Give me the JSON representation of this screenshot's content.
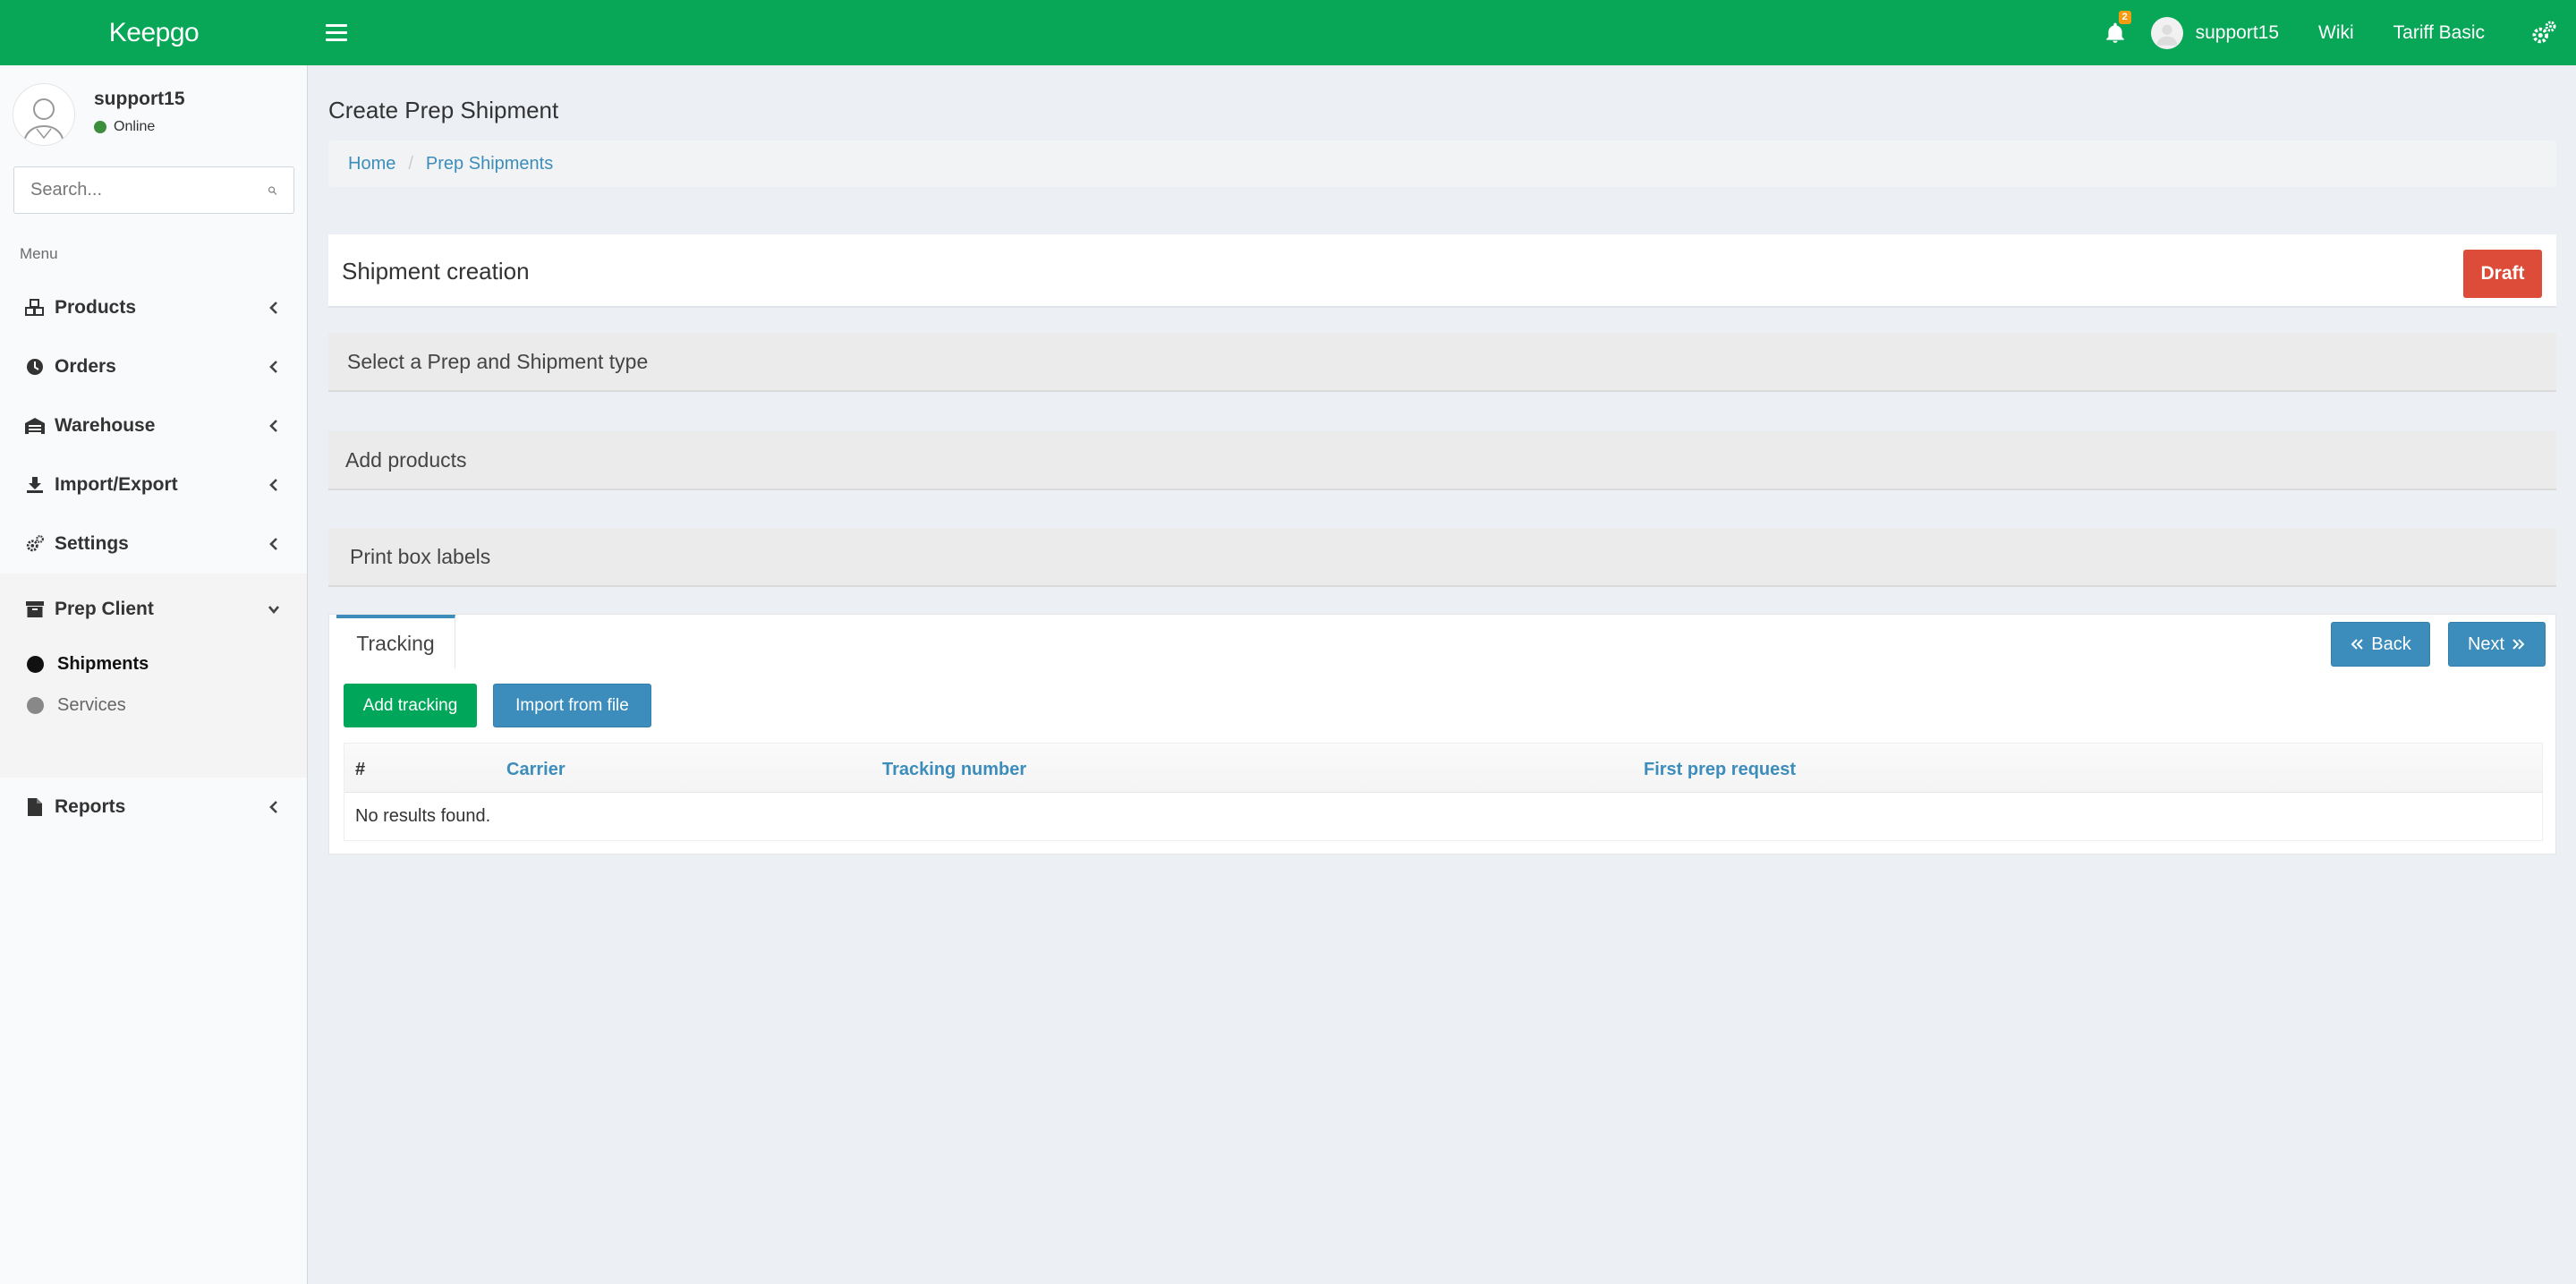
{
  "header": {
    "logo": "Keepgo",
    "notifications_count": "2",
    "username": "support15",
    "wiki": "Wiki",
    "tariff": "Tariff Basic"
  },
  "sidebar": {
    "user": {
      "name": "support15",
      "status": "Online"
    },
    "search": {
      "placeholder": "Search..."
    },
    "menu_header": "Menu",
    "items": [
      {
        "label": "Products",
        "icon": "cubes-icon"
      },
      {
        "label": "Orders",
        "icon": "clock-icon"
      },
      {
        "label": "Warehouse",
        "icon": "warehouse-icon"
      },
      {
        "label": "Import/Export",
        "icon": "download-icon"
      },
      {
        "label": "Settings",
        "icon": "gears-icon"
      },
      {
        "label": "Prep Client",
        "icon": "archive-icon"
      },
      {
        "label": "Reports",
        "icon": "file-icon"
      }
    ],
    "subitems": [
      {
        "label": "Shipments",
        "active": true
      },
      {
        "label": "Services",
        "active": false
      }
    ]
  },
  "content": {
    "page_title": "Create Prep Shipment",
    "breadcrumb": {
      "home": "Home",
      "current": "Prep Shipments"
    },
    "creation": {
      "title": "Shipment creation",
      "status_label": "Draft"
    },
    "steps": [
      "Select a Prep and Shipment type",
      "Add products",
      "Print box labels"
    ],
    "tracking": {
      "tab_label": "Tracking",
      "back_label": "Back",
      "next_label": "Next",
      "add_label": "Add tracking",
      "import_label": "Import from file",
      "columns": [
        "#",
        "Carrier",
        "Tracking number",
        "First prep request"
      ],
      "empty_text": "No results found."
    }
  },
  "colors": {
    "header": "#08a657",
    "primary": "#3c8dbc",
    "success": "#00a65a",
    "danger": "#dd4b39"
  }
}
